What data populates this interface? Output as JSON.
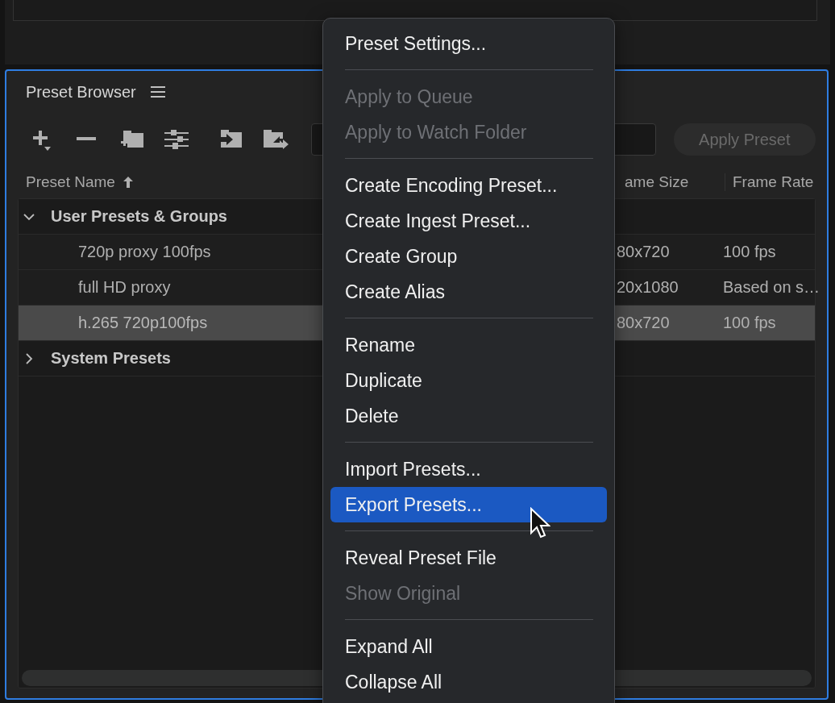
{
  "panel": {
    "title": "Preset Browser"
  },
  "toolbar": {
    "apply_button": {
      "label": "Apply Preset",
      "disabled": true
    }
  },
  "table": {
    "columns": [
      {
        "label": "Preset Name",
        "sorted": true
      },
      {
        "label": "ame Size",
        "sorted": false
      },
      {
        "label": "Frame Rate",
        "sorted": false
      }
    ],
    "groups": [
      {
        "name": "User Presets & Groups",
        "expanded": true,
        "children": [
          {
            "name": "720p proxy 100fps",
            "frame_size": "80x720",
            "frame_rate": "100 fps",
            "selected": false
          },
          {
            "name": "full HD proxy",
            "frame_size": "20x1080",
            "frame_rate": "Based on s…",
            "selected": false
          },
          {
            "name": "h.265 720p100fps",
            "frame_size": "80x720",
            "frame_rate": "100 fps",
            "selected": true
          }
        ]
      },
      {
        "name": "System Presets",
        "expanded": false
      }
    ]
  },
  "context_menu": {
    "items": [
      {
        "kind": "item",
        "label": "Preset Settings...",
        "disabled": false,
        "selected": false
      },
      {
        "kind": "separator"
      },
      {
        "kind": "item",
        "label": "Apply to Queue",
        "disabled": true,
        "selected": false
      },
      {
        "kind": "item",
        "label": "Apply to Watch Folder",
        "disabled": true,
        "selected": false
      },
      {
        "kind": "separator"
      },
      {
        "kind": "item",
        "label": "Create Encoding Preset...",
        "disabled": false,
        "selected": false
      },
      {
        "kind": "item",
        "label": "Create Ingest Preset...",
        "disabled": false,
        "selected": false
      },
      {
        "kind": "item",
        "label": "Create Group",
        "disabled": false,
        "selected": false
      },
      {
        "kind": "item",
        "label": "Create Alias",
        "disabled": false,
        "selected": false
      },
      {
        "kind": "separator"
      },
      {
        "kind": "item",
        "label": "Rename",
        "disabled": false,
        "selected": false
      },
      {
        "kind": "item",
        "label": "Duplicate",
        "disabled": false,
        "selected": false
      },
      {
        "kind": "item",
        "label": "Delete",
        "disabled": false,
        "selected": false
      },
      {
        "kind": "separator"
      },
      {
        "kind": "item",
        "label": "Import Presets...",
        "disabled": false,
        "selected": false
      },
      {
        "kind": "item",
        "label": "Export Presets...",
        "disabled": false,
        "selected": true
      },
      {
        "kind": "separator"
      },
      {
        "kind": "item",
        "label": "Reveal Preset File",
        "disabled": false,
        "selected": false
      },
      {
        "kind": "item",
        "label": "Show Original",
        "disabled": true,
        "selected": false
      },
      {
        "kind": "separator"
      },
      {
        "kind": "item",
        "label": "Expand All",
        "disabled": false,
        "selected": false
      },
      {
        "kind": "item",
        "label": "Collapse All",
        "disabled": false,
        "selected": false
      }
    ]
  }
}
